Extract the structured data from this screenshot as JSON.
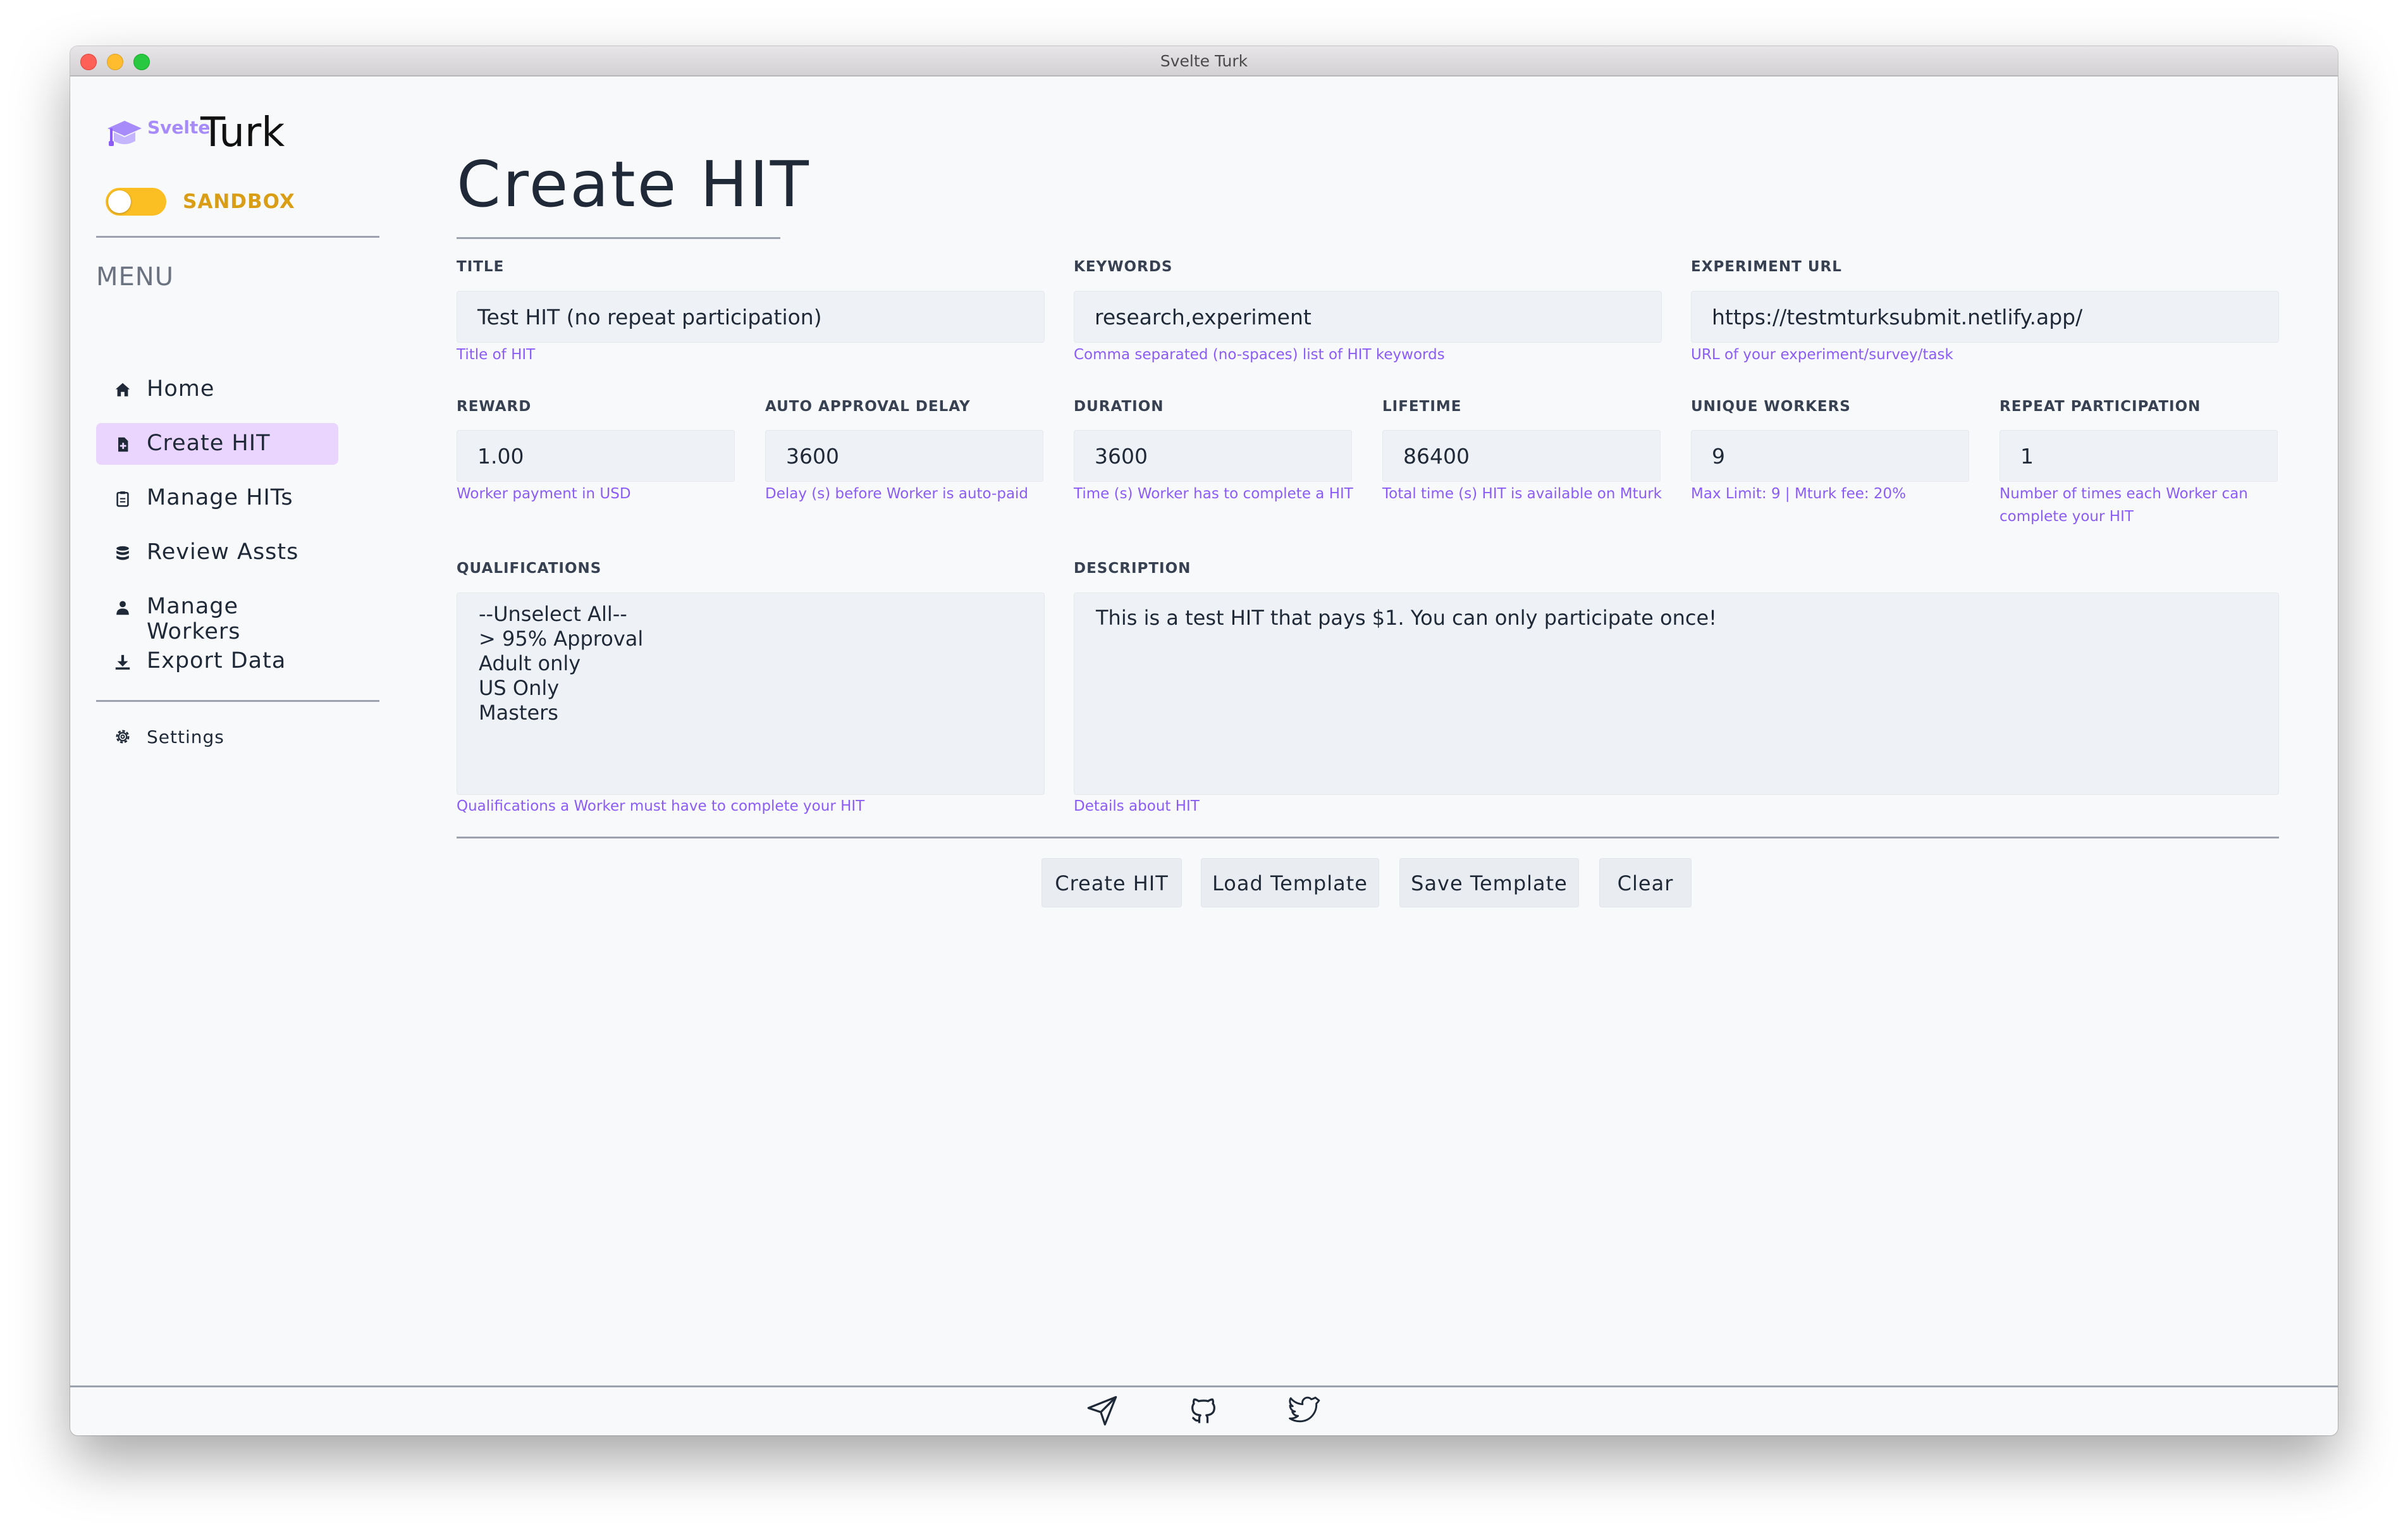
{
  "window": {
    "title": "Svelte Turk"
  },
  "brand": {
    "sub": "Svelte",
    "main": "Turk"
  },
  "sandbox": {
    "label": "SANDBOX",
    "enabled": true
  },
  "sidebar": {
    "menu_heading": "MENU",
    "items": [
      {
        "label": "Home",
        "icon": "home-icon"
      },
      {
        "label": "Create HIT",
        "icon": "file-plus-icon",
        "active": true
      },
      {
        "label": "Manage HITs",
        "icon": "clipboard-icon"
      },
      {
        "label": "Review Assts",
        "icon": "database-icon"
      },
      {
        "label": "Manage Workers",
        "icon": "user-icon"
      },
      {
        "label": "Export Data",
        "icon": "download-icon"
      }
    ],
    "settings_label": "Settings"
  },
  "page": {
    "title": "Create HIT"
  },
  "form": {
    "title": {
      "label": "TITLE",
      "value": "Test HIT (no repeat participation)",
      "help": "Title of HIT"
    },
    "keywords": {
      "label": "KEYWORDS",
      "value": "research,experiment",
      "help": "Comma separated (no-spaces) list of HIT keywords"
    },
    "experiment_url": {
      "label": "EXPERIMENT URL",
      "value": "https://testmturksubmit.netlify.app/",
      "help": "URL of your experiment/survey/task"
    },
    "reward": {
      "label": "REWARD",
      "value": "1.00",
      "help": "Worker payment in USD"
    },
    "auto_approval_delay": {
      "label": "AUTO APPROVAL DELAY",
      "value": "3600",
      "help": "Delay (s) before Worker is auto-paid"
    },
    "duration": {
      "label": "DURATION",
      "value": "3600",
      "help": "Time (s) Worker has to complete a HIT"
    },
    "lifetime": {
      "label": "LIFETIME",
      "value": "86400",
      "help": "Total time (s) HIT is available on Mturk"
    },
    "unique_workers": {
      "label": "UNIQUE WORKERS",
      "value": "9",
      "help": "Max Limit: 9 | Mturk fee: 20%"
    },
    "repeat_participation": {
      "label": "REPEAT PARTICIPATION",
      "value": "1",
      "help_line1": "Number of times each Worker can",
      "help_line2": "complete your HIT"
    },
    "qualifications": {
      "label": "QUALIFICATIONS",
      "options": [
        "--Unselect All--",
        "> 95% Approval",
        "Adult only",
        "US Only",
        "Masters"
      ],
      "help": "Qualifications a Worker must have to complete your HIT"
    },
    "description": {
      "label": "DESCRIPTION",
      "value": "This is a test HIT that pays $1. You can only participate once!",
      "help": "Details about HIT"
    }
  },
  "actions": {
    "create": "Create HIT",
    "load_template": "Load Template",
    "save_template": "Save Template",
    "clear": "Clear"
  },
  "footer": {
    "icons": [
      "send-icon",
      "github-icon",
      "twitter-icon"
    ]
  },
  "colors": {
    "accent": "#8b5cf6",
    "active_nav": "#e9d5ff",
    "sandbox": "#fbbf24"
  }
}
